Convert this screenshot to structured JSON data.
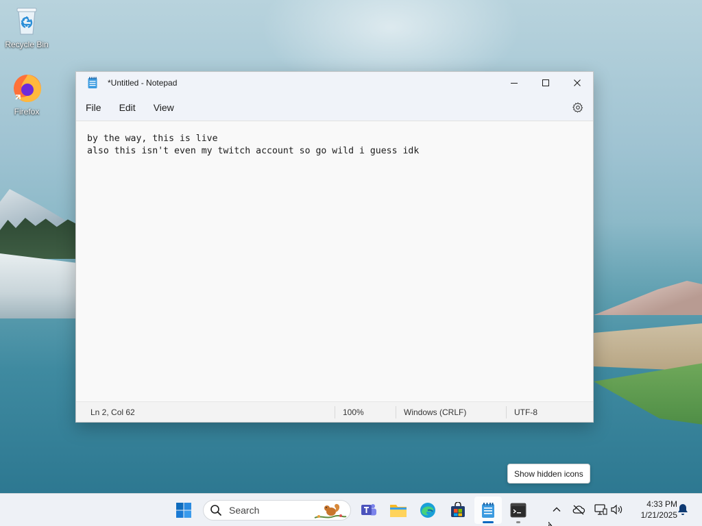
{
  "desktop": {
    "icons": [
      {
        "label": "Recycle Bin",
        "icon": "recycle-bin-icon"
      },
      {
        "label": "Firefox",
        "icon": "firefox-icon"
      }
    ]
  },
  "notepad": {
    "title": "*Untitled - Notepad",
    "menu": [
      "File",
      "Edit",
      "View"
    ],
    "content": "by the way, this is live\nalso this isn't even my twitch account so go wild i guess idk",
    "status": {
      "position": "Ln 2, Col 62",
      "zoom": "100%",
      "line_ending": "Windows (CRLF)",
      "encoding": "UTF-8"
    }
  },
  "tooltip": "Show hidden icons",
  "taskbar": {
    "search_placeholder": "Search",
    "apps": [
      "start-icon",
      "teams-icon",
      "file-explorer-icon",
      "edge-icon",
      "store-icon",
      "notepad-icon",
      "terminal-icon"
    ],
    "clock_time": "4:33 PM",
    "clock_date": "1/21/2025"
  },
  "colors": {
    "accent": "#0067c0",
    "taskbar_bg": "#eef1f6",
    "window_bg": "#f9f9f9"
  }
}
